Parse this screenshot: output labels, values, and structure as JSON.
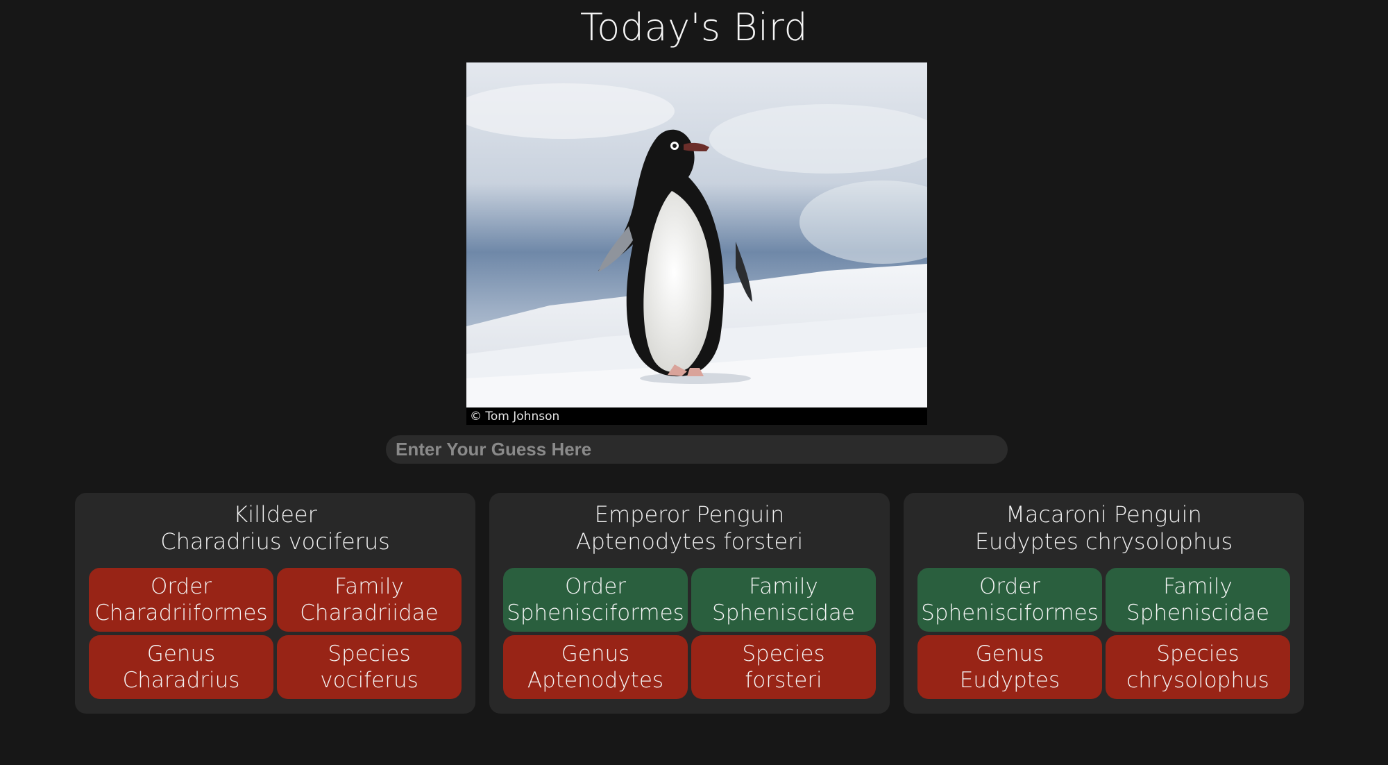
{
  "page": {
    "title": "Today's Bird",
    "photo_credit": "© Tom Johnson",
    "guess_placeholder": "Enter Your Guess Here"
  },
  "colors": {
    "background": "#171717",
    "card": "#282828",
    "input": "#2b2b2b",
    "wrong": "#982416",
    "correct": "#2a5f3e"
  },
  "guesses": [
    {
      "common_name": "Killdeer",
      "scientific_name": "Charadrius vociferus",
      "order": {
        "label": "Order",
        "value": "Charadriiformes",
        "status": "wrong"
      },
      "family": {
        "label": "Family",
        "value": "Charadriidae",
        "status": "wrong"
      },
      "genus": {
        "label": "Genus",
        "value": "Charadrius",
        "status": "wrong"
      },
      "species": {
        "label": "Species",
        "value": "vociferus",
        "status": "wrong"
      }
    },
    {
      "common_name": "Emperor Penguin",
      "scientific_name": "Aptenodytes forsteri",
      "order": {
        "label": "Order",
        "value": "Sphenisciformes",
        "status": "correct"
      },
      "family": {
        "label": "Family",
        "value": "Spheniscidae",
        "status": "correct"
      },
      "genus": {
        "label": "Genus",
        "value": "Aptenodytes",
        "status": "wrong"
      },
      "species": {
        "label": "Species",
        "value": "forsteri",
        "status": "wrong"
      }
    },
    {
      "common_name": "Macaroni Penguin",
      "scientific_name": "Eudyptes chrysolophus",
      "order": {
        "label": "Order",
        "value": "Sphenisciformes",
        "status": "correct"
      },
      "family": {
        "label": "Family",
        "value": "Spheniscidae",
        "status": "correct"
      },
      "genus": {
        "label": "Genus",
        "value": "Eudyptes",
        "status": "wrong"
      },
      "species": {
        "label": "Species",
        "value": "chrysolophus",
        "status": "wrong"
      }
    }
  ]
}
